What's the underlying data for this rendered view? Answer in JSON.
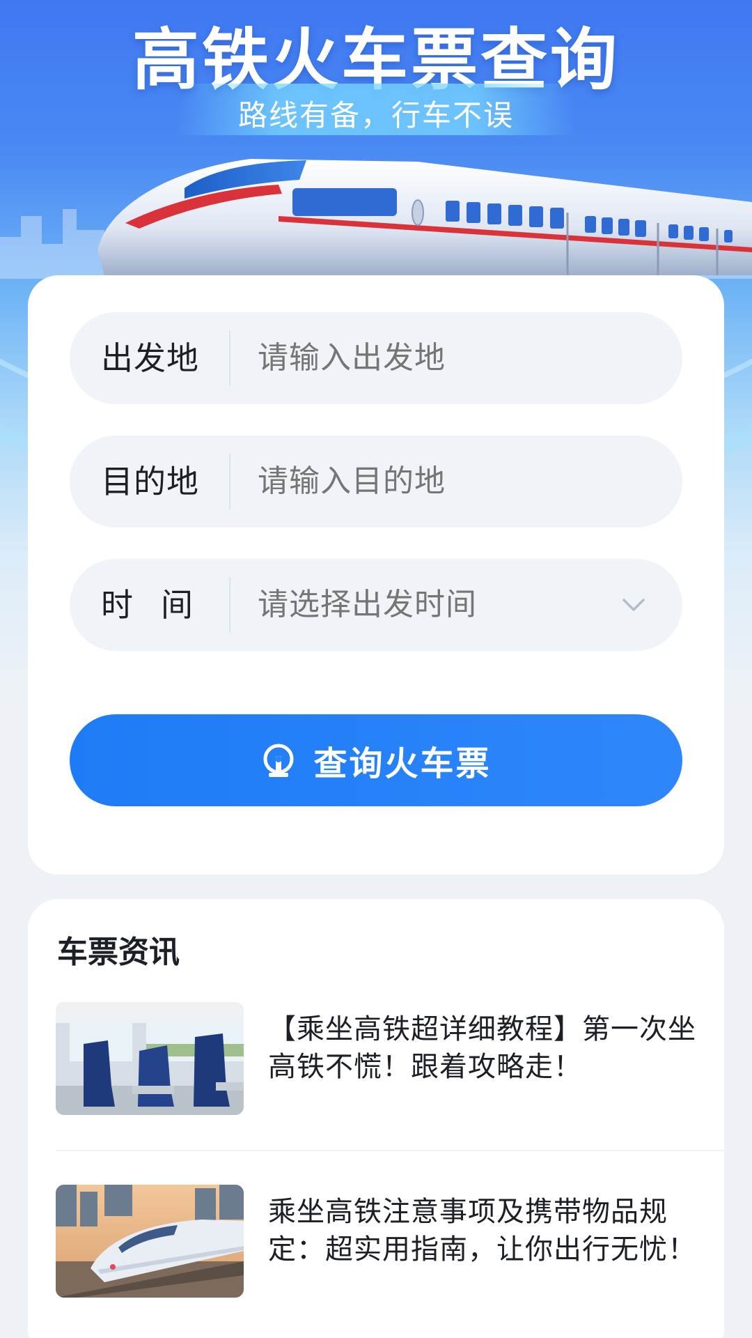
{
  "hero": {
    "title": "高铁火车票查询",
    "subtitle": "路线有备，行车不误"
  },
  "form": {
    "departure": {
      "label": "出发地",
      "placeholder": "请输入出发地"
    },
    "destination": {
      "label": "目的地",
      "placeholder": "请输入目的地"
    },
    "time": {
      "label": "时间",
      "placeholder": "请选择出发时间"
    },
    "submit_label": "查询火车票"
  },
  "news": {
    "title": "车票资讯",
    "items": [
      {
        "text": "【乘坐高铁超详细教程】第一次坐高铁不慌！跟着攻略走！"
      },
      {
        "text": "乘坐高铁注意事项及携带物品规定：超实用指南，让你出行无忧！"
      }
    ]
  },
  "colors": {
    "accent": "#1d7cf5",
    "hero_top": "#3f78f2",
    "background": "#eef2f6",
    "field_bg": "#f0f3f7",
    "placeholder": "#a9b0bd"
  },
  "icons": {
    "search_button": "railway-logo-icon",
    "time_field": "chevron-down-icon"
  }
}
